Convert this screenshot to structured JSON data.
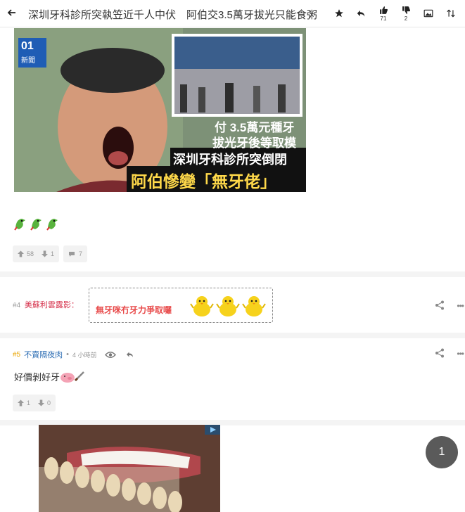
{
  "topbar": {
    "title": "深圳牙科診所突執笠近千人中伏　阿伯交3.5萬牙拔光只能食粥",
    "like_count": "71",
    "dislike_count": "2"
  },
  "post3": {
    "thumb": {
      "logo_line1": "01",
      "logo_line2": "新聞",
      "caption_line1": "付 3.5萬元種牙",
      "caption_line2": "拔光牙後等取模",
      "headline_line1": "深圳牙科診所突倒閉",
      "headline_line2": "阿伯慘變「無牙佬」"
    },
    "upvotes": "58",
    "downvotes": "1",
    "comments": "7"
  },
  "reply4": {
    "number": "#4",
    "username": "美蘇利雲露影：",
    "quote": "無牙咪冇牙力爭取囉"
  },
  "reply5": {
    "number": "#5",
    "username": "不賣隔夜肉",
    "time": "4 小時前",
    "text": "好價剝好牙",
    "upvotes": "1",
    "downvotes": "0"
  },
  "page_indicator": "1",
  "colors": {
    "accent_red": "#d6324c",
    "accent_blue": "#2b6cb3",
    "accent_gold": "#e9a500"
  }
}
